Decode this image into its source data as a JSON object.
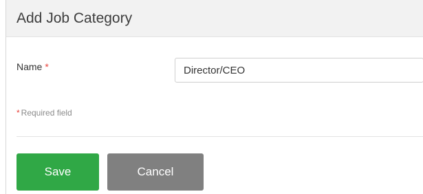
{
  "dialog": {
    "title": "Add Job Category"
  },
  "form": {
    "name_label": "Name",
    "required_marker": "*",
    "name_value": "Director/CEO",
    "required_note_marker": "*",
    "required_note_text": "Required field"
  },
  "actions": {
    "save_label": "Save",
    "cancel_label": "Cancel"
  },
  "colors": {
    "save_button": "#30a846",
    "cancel_button": "#808080",
    "required_star": "#e8413a",
    "header_background": "#f2f2f2"
  }
}
